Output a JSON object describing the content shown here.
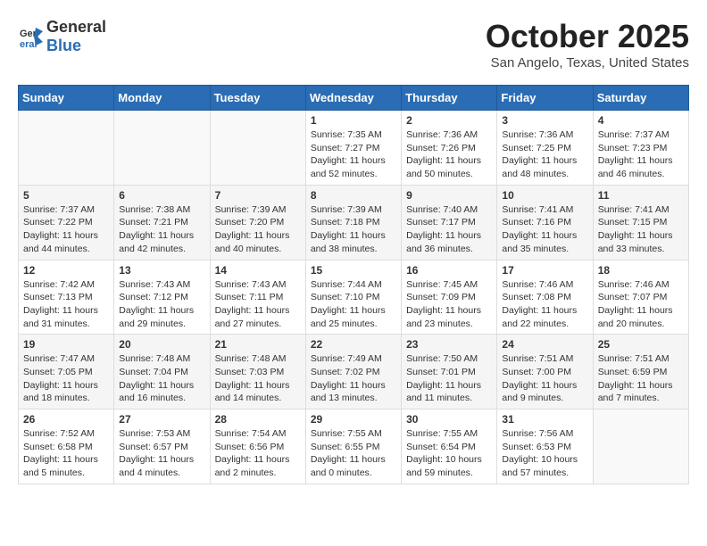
{
  "logo": {
    "text_general": "General",
    "text_blue": "Blue"
  },
  "title": {
    "month": "October 2025",
    "location": "San Angelo, Texas, United States"
  },
  "weekdays": [
    "Sunday",
    "Monday",
    "Tuesday",
    "Wednesday",
    "Thursday",
    "Friday",
    "Saturday"
  ],
  "weeks": [
    [
      {
        "day": "",
        "sunrise": "",
        "sunset": "",
        "daylight": ""
      },
      {
        "day": "",
        "sunrise": "",
        "sunset": "",
        "daylight": ""
      },
      {
        "day": "",
        "sunrise": "",
        "sunset": "",
        "daylight": ""
      },
      {
        "day": "1",
        "sunrise": "Sunrise: 7:35 AM",
        "sunset": "Sunset: 7:27 PM",
        "daylight": "Daylight: 11 hours and 52 minutes."
      },
      {
        "day": "2",
        "sunrise": "Sunrise: 7:36 AM",
        "sunset": "Sunset: 7:26 PM",
        "daylight": "Daylight: 11 hours and 50 minutes."
      },
      {
        "day": "3",
        "sunrise": "Sunrise: 7:36 AM",
        "sunset": "Sunset: 7:25 PM",
        "daylight": "Daylight: 11 hours and 48 minutes."
      },
      {
        "day": "4",
        "sunrise": "Sunrise: 7:37 AM",
        "sunset": "Sunset: 7:23 PM",
        "daylight": "Daylight: 11 hours and 46 minutes."
      }
    ],
    [
      {
        "day": "5",
        "sunrise": "Sunrise: 7:37 AM",
        "sunset": "Sunset: 7:22 PM",
        "daylight": "Daylight: 11 hours and 44 minutes."
      },
      {
        "day": "6",
        "sunrise": "Sunrise: 7:38 AM",
        "sunset": "Sunset: 7:21 PM",
        "daylight": "Daylight: 11 hours and 42 minutes."
      },
      {
        "day": "7",
        "sunrise": "Sunrise: 7:39 AM",
        "sunset": "Sunset: 7:20 PM",
        "daylight": "Daylight: 11 hours and 40 minutes."
      },
      {
        "day": "8",
        "sunrise": "Sunrise: 7:39 AM",
        "sunset": "Sunset: 7:18 PM",
        "daylight": "Daylight: 11 hours and 38 minutes."
      },
      {
        "day": "9",
        "sunrise": "Sunrise: 7:40 AM",
        "sunset": "Sunset: 7:17 PM",
        "daylight": "Daylight: 11 hours and 36 minutes."
      },
      {
        "day": "10",
        "sunrise": "Sunrise: 7:41 AM",
        "sunset": "Sunset: 7:16 PM",
        "daylight": "Daylight: 11 hours and 35 minutes."
      },
      {
        "day": "11",
        "sunrise": "Sunrise: 7:41 AM",
        "sunset": "Sunset: 7:15 PM",
        "daylight": "Daylight: 11 hours and 33 minutes."
      }
    ],
    [
      {
        "day": "12",
        "sunrise": "Sunrise: 7:42 AM",
        "sunset": "Sunset: 7:13 PM",
        "daylight": "Daylight: 11 hours and 31 minutes."
      },
      {
        "day": "13",
        "sunrise": "Sunrise: 7:43 AM",
        "sunset": "Sunset: 7:12 PM",
        "daylight": "Daylight: 11 hours and 29 minutes."
      },
      {
        "day": "14",
        "sunrise": "Sunrise: 7:43 AM",
        "sunset": "Sunset: 7:11 PM",
        "daylight": "Daylight: 11 hours and 27 minutes."
      },
      {
        "day": "15",
        "sunrise": "Sunrise: 7:44 AM",
        "sunset": "Sunset: 7:10 PM",
        "daylight": "Daylight: 11 hours and 25 minutes."
      },
      {
        "day": "16",
        "sunrise": "Sunrise: 7:45 AM",
        "sunset": "Sunset: 7:09 PM",
        "daylight": "Daylight: 11 hours and 23 minutes."
      },
      {
        "day": "17",
        "sunrise": "Sunrise: 7:46 AM",
        "sunset": "Sunset: 7:08 PM",
        "daylight": "Daylight: 11 hours and 22 minutes."
      },
      {
        "day": "18",
        "sunrise": "Sunrise: 7:46 AM",
        "sunset": "Sunset: 7:07 PM",
        "daylight": "Daylight: 11 hours and 20 minutes."
      }
    ],
    [
      {
        "day": "19",
        "sunrise": "Sunrise: 7:47 AM",
        "sunset": "Sunset: 7:05 PM",
        "daylight": "Daylight: 11 hours and 18 minutes."
      },
      {
        "day": "20",
        "sunrise": "Sunrise: 7:48 AM",
        "sunset": "Sunset: 7:04 PM",
        "daylight": "Daylight: 11 hours and 16 minutes."
      },
      {
        "day": "21",
        "sunrise": "Sunrise: 7:48 AM",
        "sunset": "Sunset: 7:03 PM",
        "daylight": "Daylight: 11 hours and 14 minutes."
      },
      {
        "day": "22",
        "sunrise": "Sunrise: 7:49 AM",
        "sunset": "Sunset: 7:02 PM",
        "daylight": "Daylight: 11 hours and 13 minutes."
      },
      {
        "day": "23",
        "sunrise": "Sunrise: 7:50 AM",
        "sunset": "Sunset: 7:01 PM",
        "daylight": "Daylight: 11 hours and 11 minutes."
      },
      {
        "day": "24",
        "sunrise": "Sunrise: 7:51 AM",
        "sunset": "Sunset: 7:00 PM",
        "daylight": "Daylight: 11 hours and 9 minutes."
      },
      {
        "day": "25",
        "sunrise": "Sunrise: 7:51 AM",
        "sunset": "Sunset: 6:59 PM",
        "daylight": "Daylight: 11 hours and 7 minutes."
      }
    ],
    [
      {
        "day": "26",
        "sunrise": "Sunrise: 7:52 AM",
        "sunset": "Sunset: 6:58 PM",
        "daylight": "Daylight: 11 hours and 5 minutes."
      },
      {
        "day": "27",
        "sunrise": "Sunrise: 7:53 AM",
        "sunset": "Sunset: 6:57 PM",
        "daylight": "Daylight: 11 hours and 4 minutes."
      },
      {
        "day": "28",
        "sunrise": "Sunrise: 7:54 AM",
        "sunset": "Sunset: 6:56 PM",
        "daylight": "Daylight: 11 hours and 2 minutes."
      },
      {
        "day": "29",
        "sunrise": "Sunrise: 7:55 AM",
        "sunset": "Sunset: 6:55 PM",
        "daylight": "Daylight: 11 hours and 0 minutes."
      },
      {
        "day": "30",
        "sunrise": "Sunrise: 7:55 AM",
        "sunset": "Sunset: 6:54 PM",
        "daylight": "Daylight: 10 hours and 59 minutes."
      },
      {
        "day": "31",
        "sunrise": "Sunrise: 7:56 AM",
        "sunset": "Sunset: 6:53 PM",
        "daylight": "Daylight: 10 hours and 57 minutes."
      },
      {
        "day": "",
        "sunrise": "",
        "sunset": "",
        "daylight": ""
      }
    ]
  ]
}
